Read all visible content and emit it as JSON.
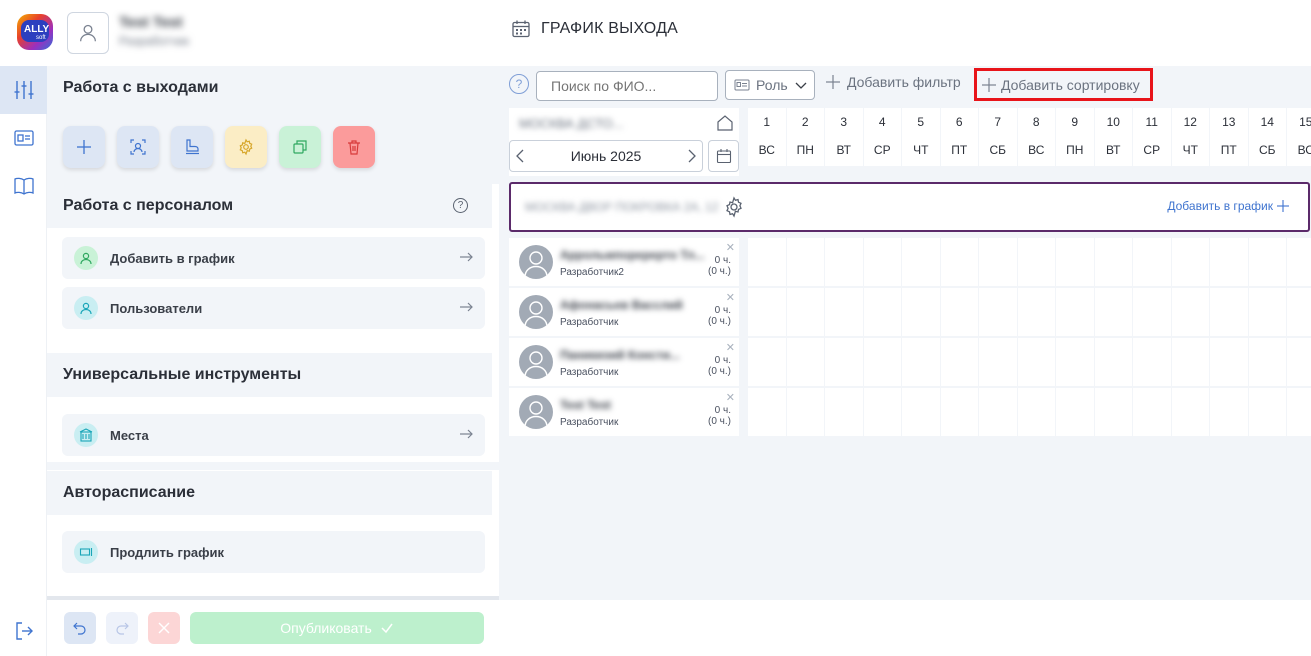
{
  "app": {
    "logo_text": "ALLY",
    "logo_sub": "soft",
    "user_name": "Test Test",
    "user_role": "Разработчик",
    "page_title": "ГРАФИК ВЫХОДА"
  },
  "panel": {
    "sections": {
      "exits": "Работа с выходами",
      "staff": "Работа с персоналом",
      "universal": "Универсальные инструменты",
      "auto": "Авторасписание"
    },
    "items": {
      "add_to_schedule": "Добавить в график",
      "users": "Пользователи",
      "places": "Места",
      "extend": "Продлить график"
    },
    "help_icon": "question-circle-icon"
  },
  "bottom": {
    "publish": "Опубликовать"
  },
  "toolbar": {
    "help": "?",
    "search_placeholder": "Поиск по ФИО...",
    "role": "Роль",
    "add_filter": "Добавить фильтр",
    "add_sort": "Добавить сортировку"
  },
  "calendar": {
    "place": "МОСКВА ДСТО...",
    "month": "Июнь 2025",
    "days": [
      {
        "n": "1",
        "w": "ВС"
      },
      {
        "n": "2",
        "w": "ПН"
      },
      {
        "n": "3",
        "w": "ВТ"
      },
      {
        "n": "4",
        "w": "СР"
      },
      {
        "n": "5",
        "w": "ЧТ"
      },
      {
        "n": "6",
        "w": "ПТ"
      },
      {
        "n": "7",
        "w": "СБ"
      },
      {
        "n": "8",
        "w": "ВС"
      },
      {
        "n": "9",
        "w": "ПН"
      },
      {
        "n": "10",
        "w": "ВТ"
      },
      {
        "n": "11",
        "w": "СР"
      },
      {
        "n": "12",
        "w": "ЧТ"
      },
      {
        "n": "13",
        "w": "ПТ"
      },
      {
        "n": "14",
        "w": "СБ"
      },
      {
        "n": "15",
        "w": "ВС"
      }
    ]
  },
  "group": {
    "name": "МОСКВА ДВОР ПОКРОВКА 2А, 12",
    "add_label": "Добавить в график"
  },
  "employees": [
    {
      "name": "Аррольмпоререрто Тл...",
      "role": "Разработчик2",
      "hours": "0 ч.",
      "sub": "(0 ч.)"
    },
    {
      "name": "Афонасьев Васслий",
      "role": "Разработчик",
      "hours": "0 ч.",
      "sub": "(0 ч.)"
    },
    {
      "name": "Паникиэий Консти...",
      "role": "Разработчик",
      "hours": "0 ч.",
      "sub": "(0 ч.)"
    },
    {
      "name": "Test Test",
      "role": "Разработчик",
      "hours": "0 ч.",
      "sub": "(0 ч.)"
    }
  ],
  "colors": {
    "accent": "#3f74cf",
    "group_border": "#5b2a6a",
    "sort_highlight": "#e8141a",
    "publish_bg": "#bdf0cd",
    "panel_bg": "#f2f5f9"
  }
}
